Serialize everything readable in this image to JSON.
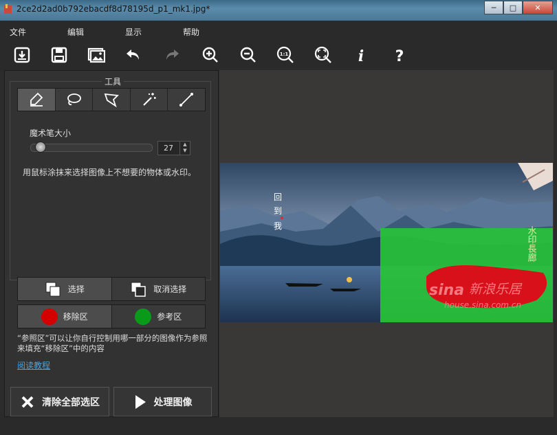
{
  "window": {
    "title": "2ce2d2ad0b792ebacdf8d78195d_p1_mk1.jpg*"
  },
  "menu": [
    "文件",
    "编辑",
    "显示",
    "帮助"
  ],
  "toolbar_icons": [
    "open-icon",
    "save-icon",
    "image-icon",
    "undo-icon",
    "redo-icon",
    "zoom-in-icon",
    "zoom-out-icon",
    "actual-size-icon",
    "fit-icon",
    "info-icon",
    "help-icon"
  ],
  "tools": {
    "title": "工具",
    "brush_size_label": "魔术笔大小",
    "brush_size_value": "27",
    "brush_size_fraction": 0.06,
    "hint": "用鼠标涂抹来选择图像上不想要的物体或水印。",
    "select_label": "选择",
    "deselect_label": "取消选择",
    "remove_label": "移除区",
    "reference_label": "参考区",
    "reference_note": "“参照区”可以让你自行控制用哪一部分的图像作为参照来填充“移除区”中的内容",
    "tutorial_link": "阅读教程"
  },
  "actions": {
    "clear_label": "清除全部选区",
    "process_label": "处理图像"
  },
  "image": {
    "poem_chars": [
      "回",
      "到",
      "我"
    ],
    "watermark_cn": "新浪乐居",
    "watermark_brand": "sina",
    "watermark_url": "house.sina.com.cn",
    "side_text": "水印長廊"
  },
  "colors": {
    "remove": "#d40000",
    "reference": "#0a9a1a",
    "link": "#4aa3df"
  }
}
